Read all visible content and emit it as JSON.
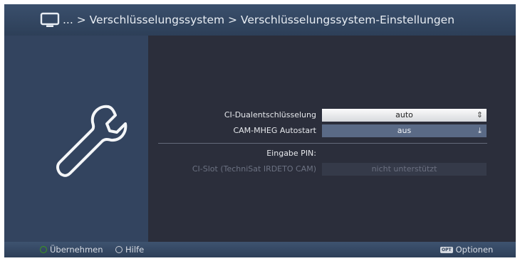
{
  "header": {
    "breadcrumb": "... > Verschlüsselungssystem > Verschlüsselungssystem-Einstellungen",
    "icon": "tv-icon"
  },
  "side_panel": {
    "icon": "wrench-icon"
  },
  "settings": [
    {
      "label": "CI-Dualentschlüsselung",
      "value": "auto",
      "state": "selected"
    },
    {
      "label": "CAM-MHEG Autostart",
      "value": "aus",
      "state": "normal"
    },
    {
      "label": "Eingabe PIN:"
    },
    {
      "label": "CI-Slot (TechniSat IRDETO CAM)",
      "value": "nicht unterstützt",
      "state": "disabled"
    }
  ],
  "footer": {
    "accept_label": "Übernehmen",
    "accept_color": "#3c9a1c",
    "help_label": "Hilfe",
    "help_color": "#ffffff",
    "options_key": "OPT",
    "options_label": "Optionen"
  }
}
